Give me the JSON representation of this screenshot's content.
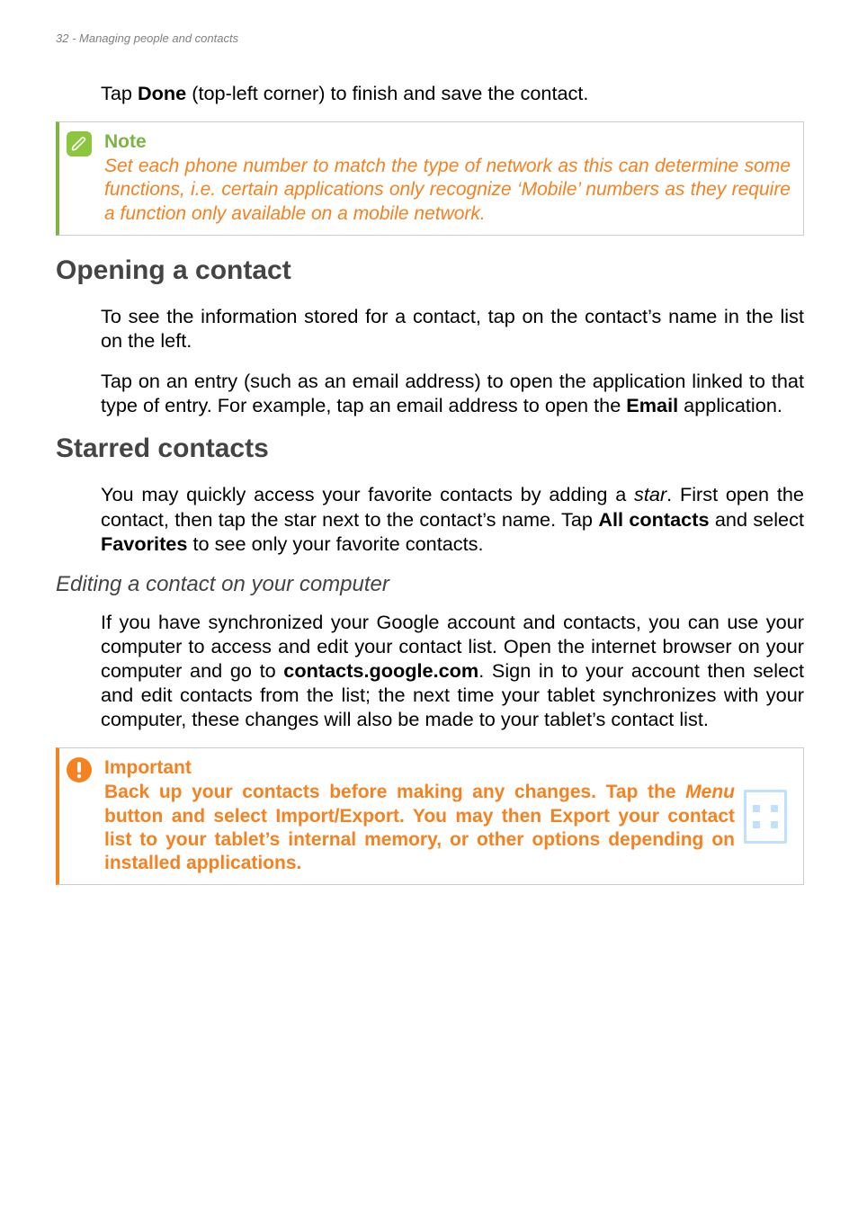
{
  "header": "32 - Managing people and contacts",
  "intro": {
    "pre": "Tap ",
    "bold": "Done",
    "post": " (top-left corner) to finish and save the contact."
  },
  "note": {
    "title": "Note",
    "body": "Set each phone number to match the type of network as this can determine some functions, i.e. certain applications only recognize ‘Mobile’ numbers as they require a function only available on a mobile network."
  },
  "sections": {
    "opening": {
      "title": "Opening a contact",
      "p1": "To see the information stored for a contact, tap on the contact’s name in the list on the left.",
      "p2_pre": "Tap on an entry (such as an email address) to open the application linked to that type of entry. For example, tap an email address to open the ",
      "p2_bold": "Email",
      "p2_post": " application."
    },
    "starred": {
      "title": "Starred contacts",
      "p1_a": "You may quickly access your favorite contacts by adding a ",
      "p1_star": "star",
      "p1_b": ". First open the contact, then tap the star next to the contact’s name. Tap ",
      "p1_all": "All contacts",
      "p1_c": "  and select ",
      "p1_fav": "Favorites",
      "p1_d": " to see only your favorite contacts."
    },
    "editing": {
      "title": "Editing a contact on your computer",
      "p1_a": "If you have synchronized your Google account and contacts, you can use your computer to access and edit your contact list. Open the internet browser on your computer and go to ",
      "p1_url": "contacts.google.com",
      "p1_b": ". Sign in to your account then select and edit contacts from the list; the next time your tablet synchronizes with your computer, these changes will also be made to your tablet’s contact list."
    }
  },
  "important": {
    "title": "Important",
    "body_a": "Back up your contacts before making any changes. Tap the ",
    "body_menu": "Menu",
    "body_b": " button and select Import/Export. You may then Export your contact list to your tablet’s internal memory, or other options depending on installed applications."
  }
}
